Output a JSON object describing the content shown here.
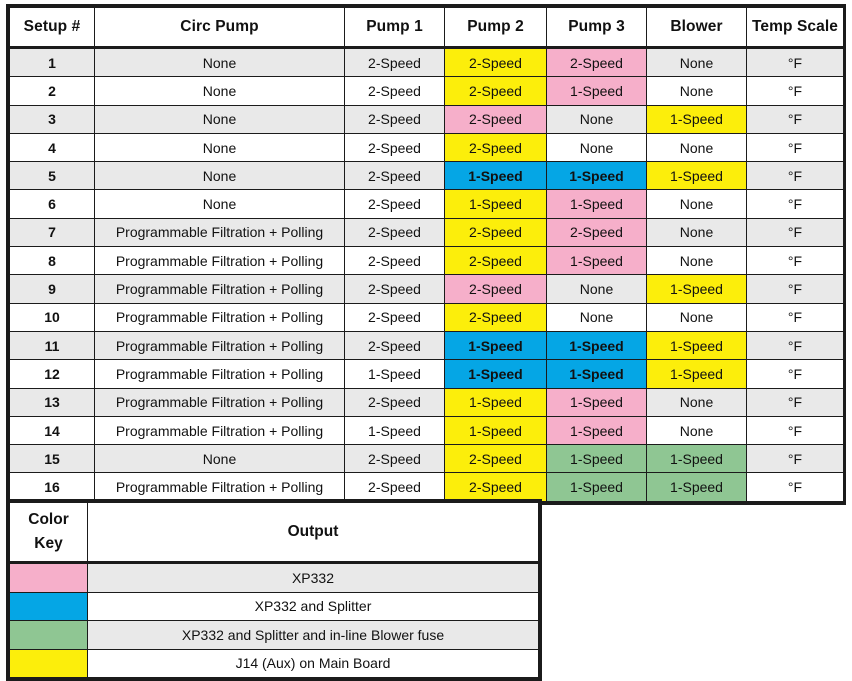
{
  "setup_table": {
    "columns": [
      "Setup #",
      "Circ Pump",
      "Pump 1",
      "Pump 2",
      "Pump 3",
      "Blower",
      "Temp Scale"
    ],
    "rows": [
      {
        "setup": "1",
        "circ": "None",
        "p1": "2-Speed",
        "p2": "2-Speed",
        "p3": "2-Speed",
        "blower": "None",
        "temp": "°F",
        "p2_color": "yellow",
        "p3_color": "pink",
        "blower_color": "none"
      },
      {
        "setup": "2",
        "circ": "None",
        "p1": "2-Speed",
        "p2": "2-Speed",
        "p3": "1-Speed",
        "blower": "None",
        "temp": "°F",
        "p2_color": "yellow",
        "p3_color": "pink",
        "blower_color": "none"
      },
      {
        "setup": "3",
        "circ": "None",
        "p1": "2-Speed",
        "p2": "2-Speed",
        "p3": "None",
        "blower": "1-Speed",
        "temp": "°F",
        "p2_color": "pink",
        "p3_color": "none",
        "blower_color": "yellow"
      },
      {
        "setup": "4",
        "circ": "None",
        "p1": "2-Speed",
        "p2": "2-Speed",
        "p3": "None",
        "blower": "None",
        "temp": "°F",
        "p2_color": "yellow",
        "p3_color": "none",
        "blower_color": "none"
      },
      {
        "setup": "5",
        "circ": "None",
        "p1": "2-Speed",
        "p2": "1-Speed",
        "p3": "1-Speed",
        "blower": "1-Speed",
        "temp": "°F",
        "p2_color": "blue",
        "p3_color": "blue",
        "blower_color": "yellow"
      },
      {
        "setup": "6",
        "circ": "None",
        "p1": "2-Speed",
        "p2": "1-Speed",
        "p3": "1-Speed",
        "blower": "None",
        "temp": "°F",
        "p2_color": "yellow",
        "p3_color": "pink",
        "blower_color": "none"
      },
      {
        "setup": "7",
        "circ": "Programmable Filtration + Polling",
        "p1": "2-Speed",
        "p2": "2-Speed",
        "p3": "2-Speed",
        "blower": "None",
        "temp": "°F",
        "p2_color": "yellow",
        "p3_color": "pink",
        "blower_color": "none"
      },
      {
        "setup": "8",
        "circ": "Programmable Filtration + Polling",
        "p1": "2-Speed",
        "p2": "2-Speed",
        "p3": "1-Speed",
        "blower": "None",
        "temp": "°F",
        "p2_color": "yellow",
        "p3_color": "pink",
        "blower_color": "none"
      },
      {
        "setup": "9",
        "circ": "Programmable Filtration + Polling",
        "p1": "2-Speed",
        "p2": "2-Speed",
        "p3": "None",
        "blower": "1-Speed",
        "temp": "°F",
        "p2_color": "pink",
        "p3_color": "none",
        "blower_color": "yellow"
      },
      {
        "setup": "10",
        "circ": "Programmable Filtration + Polling",
        "p1": "2-Speed",
        "p2": "2-Speed",
        "p3": "None",
        "blower": "None",
        "temp": "°F",
        "p2_color": "yellow",
        "p3_color": "none",
        "blower_color": "none"
      },
      {
        "setup": "11",
        "circ": "Programmable Filtration + Polling",
        "p1": "2-Speed",
        "p2": "1-Speed",
        "p3": "1-Speed",
        "blower": "1-Speed",
        "temp": "°F",
        "p2_color": "blue",
        "p3_color": "blue",
        "blower_color": "yellow"
      },
      {
        "setup": "12",
        "circ": "Programmable Filtration + Polling",
        "p1": "1-Speed",
        "p2": "1-Speed",
        "p3": "1-Speed",
        "blower": "1-Speed",
        "temp": "°F",
        "p2_color": "blue",
        "p3_color": "blue",
        "blower_color": "yellow"
      },
      {
        "setup": "13",
        "circ": "Programmable Filtration + Polling",
        "p1": "2-Speed",
        "p2": "1-Speed",
        "p3": "1-Speed",
        "blower": "None",
        "temp": "°F",
        "p2_color": "yellow",
        "p3_color": "pink",
        "blower_color": "none"
      },
      {
        "setup": "14",
        "circ": "Programmable Filtration + Polling",
        "p1": "1-Speed",
        "p2": "1-Speed",
        "p3": "1-Speed",
        "blower": "None",
        "temp": "°F",
        "p2_color": "yellow",
        "p3_color": "pink",
        "blower_color": "none"
      },
      {
        "setup": "15",
        "circ": "None",
        "p1": "2-Speed",
        "p2": "2-Speed",
        "p3": "1-Speed",
        "blower": "1-Speed",
        "temp": "°F",
        "p2_color": "yellow",
        "p3_color": "green",
        "blower_color": "green"
      },
      {
        "setup": "16",
        "circ": "Programmable Filtration + Polling",
        "p1": "2-Speed",
        "p2": "2-Speed",
        "p3": "1-Speed",
        "blower": "1-Speed",
        "temp": "°F",
        "p2_color": "yellow",
        "p3_color": "green",
        "blower_color": "green"
      }
    ]
  },
  "color_key": {
    "header_swatch_line1": "Color",
    "header_swatch_line2": "Key",
    "header_output": "Output",
    "rows": [
      {
        "color": "pink",
        "hex": "#f6afca",
        "output": "XP332"
      },
      {
        "color": "blue",
        "hex": "#05a6e5",
        "output": "XP332 and Splitter"
      },
      {
        "color": "green",
        "hex": "#8fc693",
        "output": "XP332 and Splitter and in-line Blower fuse"
      },
      {
        "color": "yellow",
        "hex": "#fcee0b",
        "output": "J14 (Aux) on Main Board"
      }
    ]
  },
  "palette": {
    "pink": "#f6afca",
    "blue": "#05a6e5",
    "green": "#8fc693",
    "yellow": "#fcee0b",
    "row_shade": "#e9e9e9",
    "border": "#1b1b1b"
  }
}
